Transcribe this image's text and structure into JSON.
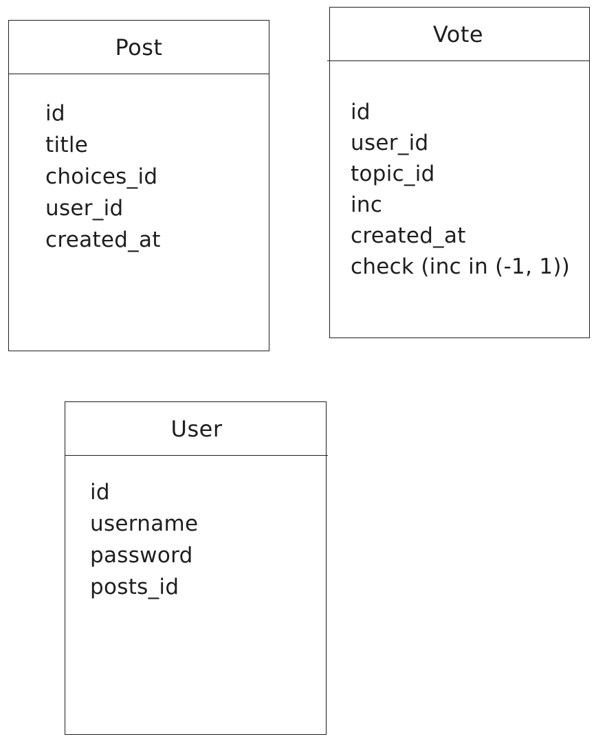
{
  "diagram": {
    "entities": [
      {
        "title": "Post",
        "fields": [
          "id",
          "title",
          "choices_id",
          "user_id",
          "created_at"
        ]
      },
      {
        "title": "Vote",
        "fields": [
          "id",
          "user_id",
          "topic_id",
          "inc",
          "created_at",
          "check (inc in (-1, 1))"
        ]
      },
      {
        "title": "User",
        "fields": [
          "id",
          "username",
          "password",
          "posts_id"
        ]
      }
    ]
  }
}
